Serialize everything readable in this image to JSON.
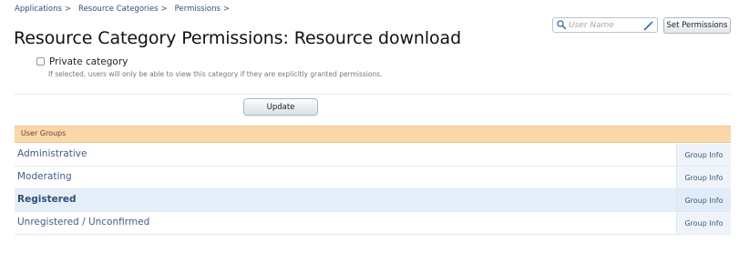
{
  "breadcrumb": {
    "items": [
      {
        "label": "Applications",
        "sep": ">"
      },
      {
        "label": "Resource Categories",
        "sep": ">"
      },
      {
        "label": "Permissions",
        "sep": ">"
      }
    ]
  },
  "page": {
    "title": "Resource Category Permissions: Resource download"
  },
  "header": {
    "search_placeholder": "User Name",
    "set_permissions_label": "Set Permissions"
  },
  "form": {
    "private_label": "Private category",
    "private_checked": false,
    "private_hint": "If selected, users will only be able to view this category if they are explicitly granted permissions.",
    "update_label": "Update"
  },
  "groups": {
    "header": "User Groups",
    "info_label": "Group Info",
    "items": [
      {
        "name": "Administrative",
        "highlight": false
      },
      {
        "name": "Moderating",
        "highlight": false
      },
      {
        "name": "Registered",
        "highlight": true
      },
      {
        "name": "Unregistered / Unconfirmed",
        "highlight": false
      }
    ]
  },
  "colors": {
    "accent": "#2b4f7a",
    "section_header": "#fbd6a8",
    "row_highlight": "#e4effa"
  },
  "icons": {
    "search": "search-icon",
    "user_lookup": "magic-wand-icon"
  }
}
